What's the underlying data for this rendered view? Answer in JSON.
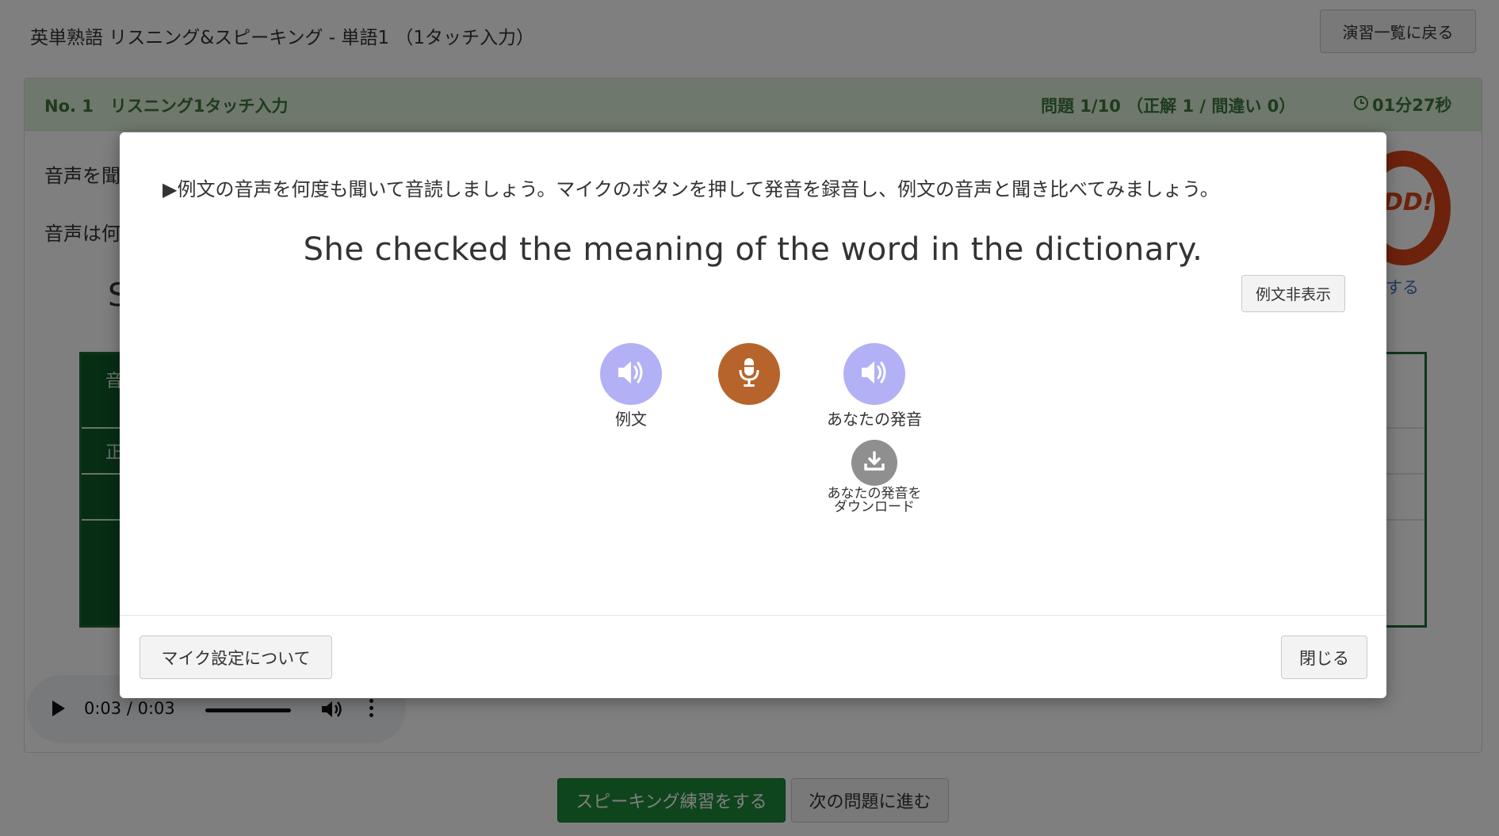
{
  "page": {
    "title": "英単熟語 リスニング&スピーキング - 単語1 （1タッチ入力）",
    "back_button": "演習一覧に戻る"
  },
  "panel": {
    "number": "No. 1　リスニング1タッチ入力",
    "progress": "問題 1/10 （正解 1 / 間違い 0）",
    "timer": "01分27秒",
    "partial_text_1": "音声を聞",
    "partial_text_2": "音声は何",
    "partial_big_letter": "S",
    "partial_row_label_1": "音",
    "partial_row_label_2": "正",
    "stamp_text": "DD!",
    "change_link_partial": "更する"
  },
  "audio_player": {
    "time": "0:03 / 0:03"
  },
  "bottom": {
    "speaking_button": "スピーキング練習をする",
    "next_button": "次の問題に進む"
  },
  "modal": {
    "instruction": "▶例文の音声を何度も聞いて音読しましょう。マイクのボタンを押して発音を録音し、例文の音声と聞き比べてみましょう。",
    "sentence": "She checked the meaning of the word in the dictionary.",
    "hide_button": "例文非表示",
    "example_label": "例文",
    "your_pronunciation_label": "あなたの発音",
    "download_label_line1": "あなたの発音を",
    "download_label_line2": "ダウンロード",
    "mic_settings_button": "マイク設定について",
    "close_button": "閉じる"
  },
  "colors": {
    "header_green_bg": "#dff0d8",
    "header_green_text": "#3c763d",
    "lavender": "#b3b1f5",
    "mic_brown": "#b6642b",
    "primary_green": "#1f8a3a",
    "stamp_orange": "#d9441b"
  },
  "icons": [
    "speaker-icon",
    "microphone-icon",
    "download-icon",
    "clock-icon",
    "play-icon",
    "volume-icon",
    "more-vert-icon"
  ]
}
